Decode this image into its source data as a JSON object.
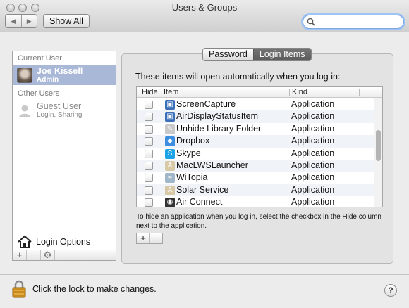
{
  "window": {
    "title": "Users & Groups"
  },
  "toolbar": {
    "back_icon": "chevron-left-icon",
    "forward_icon": "chevron-right-icon",
    "show_all_label": "Show All",
    "search_value": "",
    "search_placeholder": ""
  },
  "users_pane": {
    "current_user_header": "Current User",
    "current_user": {
      "name": "Joe Kissell",
      "role": "Admin",
      "avatar_icon": "user-photo-icon"
    },
    "other_users_header": "Other Users",
    "other_users": [
      {
        "name": "Guest User",
        "role": "Login, Sharing",
        "avatar_icon": "guest-user-icon"
      }
    ],
    "login_options_label": "Login Options",
    "buttons": [
      "+",
      "−",
      "⚙"
    ]
  },
  "tabs": [
    {
      "label": "Password",
      "active": false
    },
    {
      "label": "Login Items",
      "active": true
    }
  ],
  "login_items": {
    "intro": "These items will open automatically when you log in:",
    "columns": {
      "hide": "Hide",
      "item": "Item",
      "kind": "Kind"
    },
    "rows": [
      {
        "name": "ScreenCapture",
        "kind": "Application",
        "icon": "screen-icon",
        "hide": false
      },
      {
        "name": "AirDisplayStatusItem",
        "kind": "Application",
        "icon": "screen-icon",
        "hide": false
      },
      {
        "name": "Unhide Library Folder",
        "kind": "Application",
        "icon": "script-icon",
        "hide": false
      },
      {
        "name": "Dropbox",
        "kind": "Application",
        "icon": "dropbox-icon",
        "hide": false
      },
      {
        "name": "Skype",
        "kind": "Application",
        "icon": "skype-icon",
        "hide": false
      },
      {
        "name": "MacLWSLauncher",
        "kind": "Application",
        "icon": "app-icon",
        "hide": false
      },
      {
        "name": "WiTopia",
        "kind": "Application",
        "icon": "wifi-icon",
        "hide": false
      },
      {
        "name": "Solar Service",
        "kind": "Application",
        "icon": "app-icon",
        "hide": false
      },
      {
        "name": "Air Connect",
        "kind": "Application",
        "icon": "aperture-icon",
        "hide": false
      }
    ],
    "hint": "To hide an application when you log in, select the checkbox in the Hide column next to the application.",
    "add_label": "+",
    "remove_label": "−"
  },
  "footer": {
    "lock_text": "Click the lock to make changes.",
    "help_label": "?"
  }
}
